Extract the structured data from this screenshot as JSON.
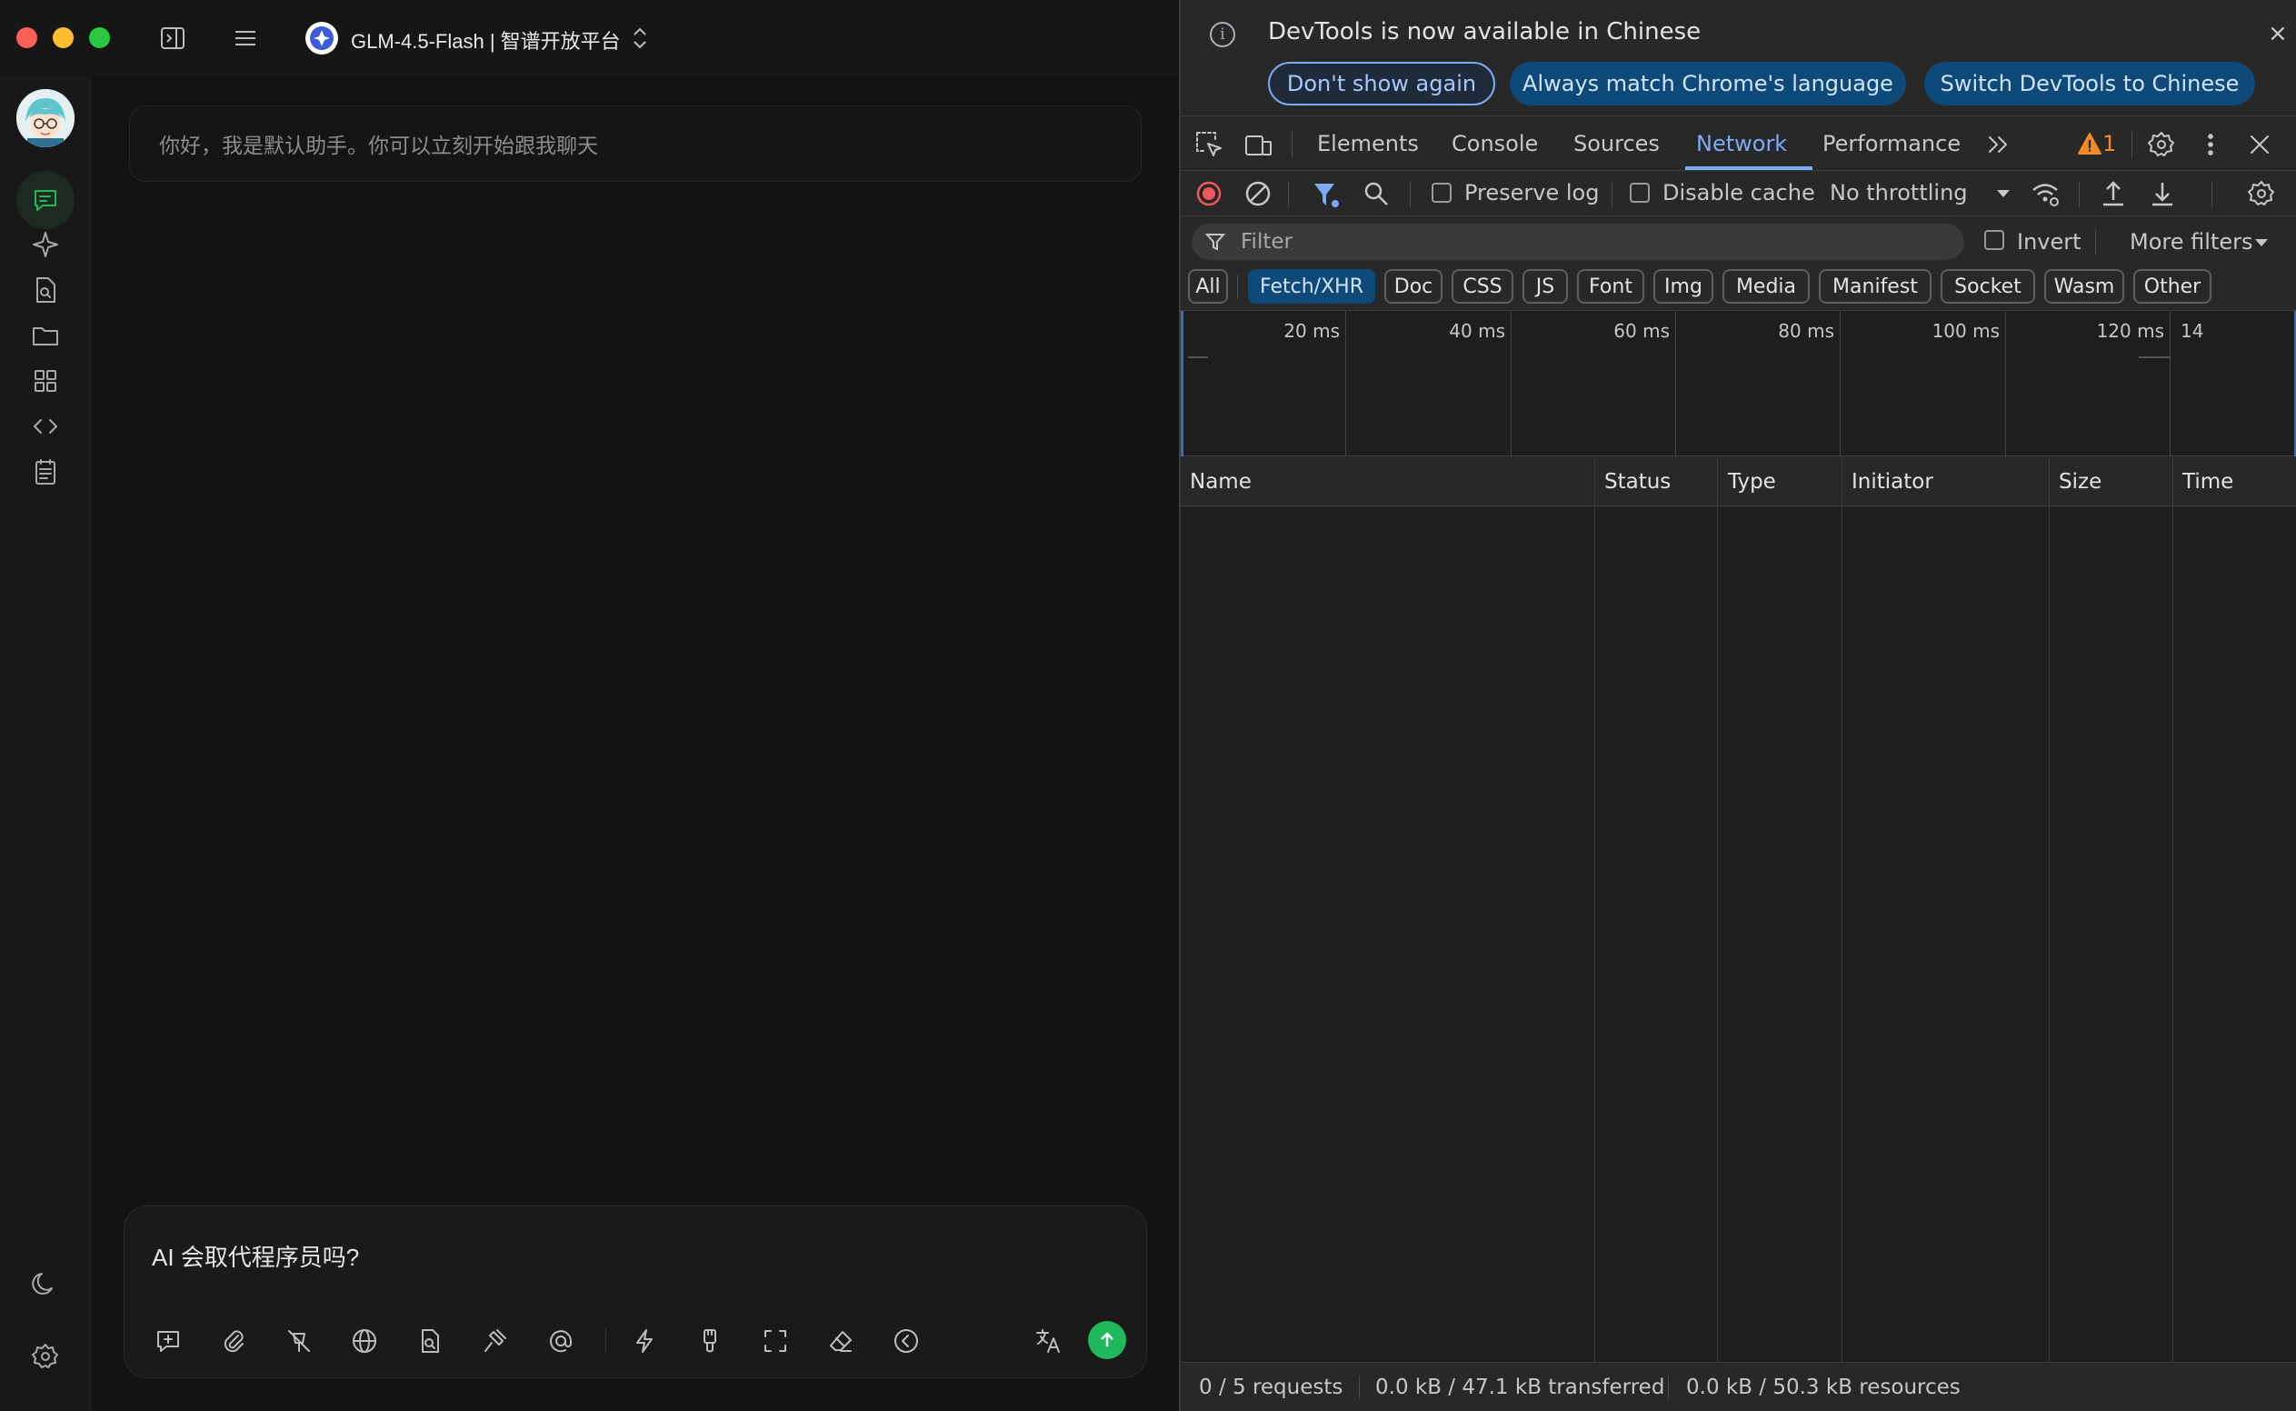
{
  "app": {
    "model_title": "GLM-4.5-Flash | 智谱开放平台",
    "greeting": "你好，我是默认助手。你可以立刻开始跟我聊天",
    "composer_text": "AI 会取代程序员吗?",
    "colors": {
      "accent": "#1fb85a",
      "background": "#131313"
    },
    "sidebar_icons": [
      "chat-icon",
      "sparkle-icon",
      "document-search-icon",
      "folder-icon",
      "apps-grid-icon",
      "code-icon",
      "notes-icon",
      "moon-icon",
      "gear-icon"
    ],
    "composer_icons": [
      "new-topic-icon",
      "paperclip-icon",
      "no-mention-icon",
      "globe-icon",
      "knowledge-file-icon",
      "hammer-icon",
      "at-icon",
      "lightning-icon",
      "brush-icon",
      "fullscreen-icon",
      "eraser-icon",
      "collapse-icon",
      "translate-icon"
    ]
  },
  "devtools": {
    "info": {
      "message": "DevTools is now available in Chinese",
      "dont_show": "Don't show again",
      "always_match": "Always match Chrome's language",
      "switch_lang": "Switch DevTools to Chinese",
      "close": "×"
    },
    "tabs": [
      "Elements",
      "Console",
      "Sources",
      "Network",
      "Performance"
    ],
    "active_tab": "Network",
    "warning_count": "1",
    "toolbar": {
      "preserve_log": "Preserve log",
      "disable_cache": "Disable cache",
      "throttling": "No throttling"
    },
    "filter": {
      "placeholder": "Filter",
      "invert": "Invert",
      "more_filters": "More filters"
    },
    "types": [
      "All",
      "Fetch/XHR",
      "Doc",
      "CSS",
      "JS",
      "Font",
      "Img",
      "Media",
      "Manifest",
      "Socket",
      "Wasm",
      "Other"
    ],
    "active_type": "Fetch/XHR",
    "timeline": [
      "20 ms",
      "40 ms",
      "60 ms",
      "80 ms",
      "100 ms",
      "120 ms",
      "14"
    ],
    "columns": [
      "Name",
      "Status",
      "Type",
      "Initiator",
      "Size",
      "Time"
    ],
    "status": {
      "requests": "0 / 5 requests",
      "transferred": "0.0 kB / 47.1 kB transferred",
      "resources": "0.0 kB / 50.3 kB resources"
    }
  }
}
